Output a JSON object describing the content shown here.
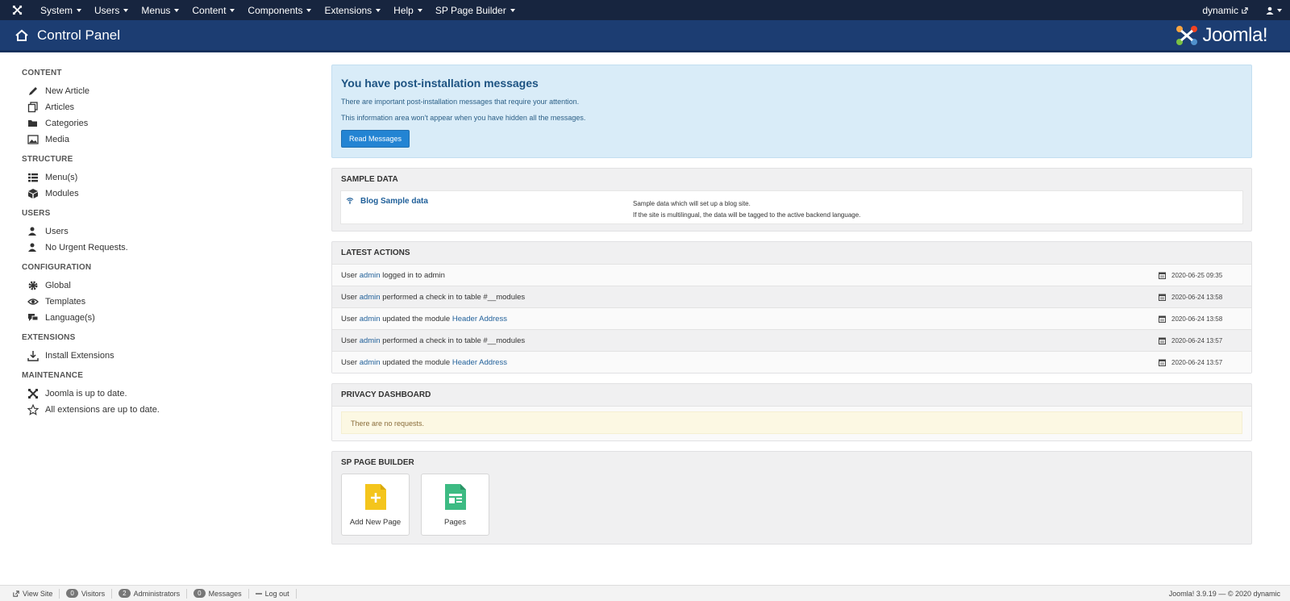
{
  "topnav": {
    "menu": [
      {
        "label": "System"
      },
      {
        "label": "Users"
      },
      {
        "label": "Menus"
      },
      {
        "label": "Content"
      },
      {
        "label": "Components"
      },
      {
        "label": "Extensions"
      },
      {
        "label": "Help"
      },
      {
        "label": "SP Page Builder"
      }
    ],
    "site_link": "dynamic"
  },
  "header": {
    "title": "Control Panel",
    "brand": "Joomla!"
  },
  "sidebar": {
    "sections": [
      {
        "heading": "CONTENT",
        "items": [
          "New Article",
          "Articles",
          "Categories",
          "Media"
        ]
      },
      {
        "heading": "STRUCTURE",
        "items": [
          "Menu(s)",
          "Modules"
        ]
      },
      {
        "heading": "USERS",
        "items": [
          "Users",
          "No Urgent Requests."
        ]
      },
      {
        "heading": "CONFIGURATION",
        "items": [
          "Global",
          "Templates",
          "Language(s)"
        ]
      },
      {
        "heading": "EXTENSIONS",
        "items": [
          "Install Extensions"
        ]
      },
      {
        "heading": "MAINTENANCE",
        "items": [
          "Joomla is up to date.",
          "All extensions are up to date."
        ]
      }
    ]
  },
  "postinstall": {
    "title": "You have post-installation messages",
    "line1": "There are important post-installation messages that require your attention.",
    "line2": "This information area won't appear when you have hidden all the messages.",
    "button": "Read Messages"
  },
  "sample_data": {
    "heading": "SAMPLE DATA",
    "name": "Blog Sample data",
    "desc1": "Sample data which will set up a blog site.",
    "desc2": "If the site is multilingual, the data will be tagged to the active backend language."
  },
  "latest_actions": {
    "heading": "LATEST ACTIONS",
    "rows": [
      {
        "pre": "User ",
        "user": "admin",
        "mid": " logged in to admin",
        "link": "",
        "date": "2020-06-25 09:35"
      },
      {
        "pre": "User ",
        "user": "admin",
        "mid": " performed a check in to table #__modules",
        "link": "",
        "date": "2020-06-24 13:58"
      },
      {
        "pre": "User ",
        "user": "admin",
        "mid": " updated the module ",
        "link": "Header Address",
        "date": "2020-06-24 13:58"
      },
      {
        "pre": "User ",
        "user": "admin",
        "mid": " performed a check in to table #__modules",
        "link": "",
        "date": "2020-06-24 13:57"
      },
      {
        "pre": "User ",
        "user": "admin",
        "mid": " updated the module ",
        "link": "Header Address",
        "date": "2020-06-24 13:57"
      }
    ]
  },
  "privacy": {
    "heading": "PRIVACY DASHBOARD",
    "message": "There are no requests."
  },
  "sp_page_builder": {
    "heading": "SP PAGE BUILDER",
    "add_new": "Add New Page",
    "pages": "Pages"
  },
  "statusbar": {
    "view_site": "View Site",
    "visitors_count": "0",
    "visitors": "Visitors",
    "admins_count": "2",
    "admins": "Administrators",
    "messages_count": "0",
    "messages": "Messages",
    "logout": "Log out",
    "version": "Joomla! 3.9.19  —  © 2020 dynamic"
  }
}
